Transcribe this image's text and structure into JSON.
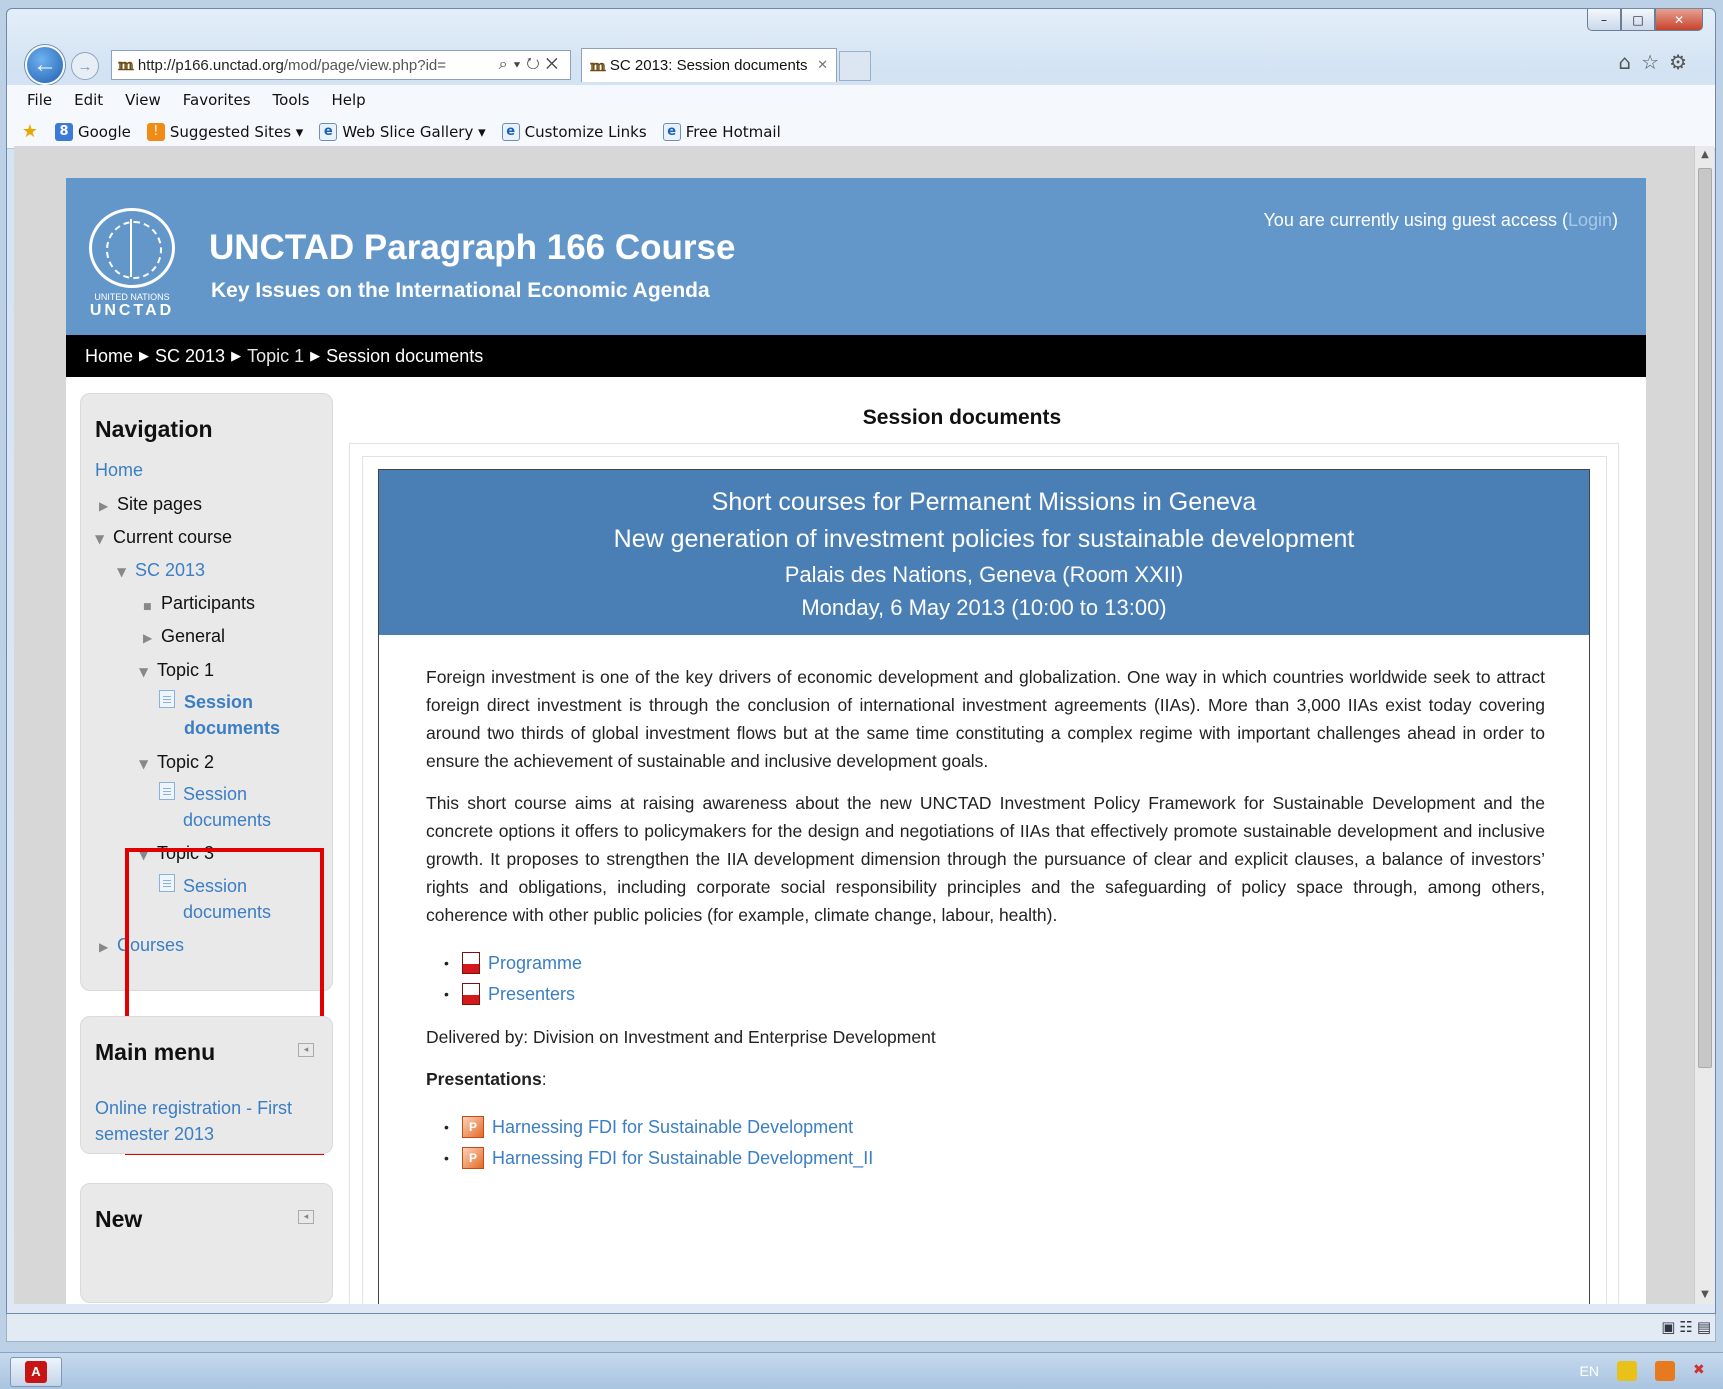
{
  "browser": {
    "url_host": "http://p166.unctad.org",
    "url_rest": "/mod/page/view.php?id=",
    "tab_title": "SC 2013: Session documents",
    "menu": [
      "File",
      "Edit",
      "View",
      "Favorites",
      "Tools",
      "Help"
    ],
    "favorites": [
      "Google",
      "Suggested Sites ▾",
      "Web Slice Gallery ▾",
      "Customize Links",
      "Free Hotmail"
    ]
  },
  "header": {
    "logo_line1": "UNITED NATIONS",
    "logo_line2": "UNCTAD",
    "title": "UNCTAD Paragraph 166 Course",
    "subtitle": "Key Issues on the International Economic Agenda",
    "guest_text": "You are currently using guest access (",
    "login_label": "Login",
    "guest_close": ")"
  },
  "breadcrumb": [
    "Home",
    "SC 2013",
    "Topic 1",
    "Session documents"
  ],
  "navigation": {
    "title": "Navigation",
    "home": "Home",
    "site_pages": "Site pages",
    "current_course": "Current course",
    "sc2013": "SC 2013",
    "participants": "Participants",
    "general": "General",
    "topic1": "Topic 1",
    "topic2": "Topic 2",
    "topic3": "Topic 3",
    "session": "Session",
    "documents": "documents",
    "courses": "Courses"
  },
  "main_menu": {
    "title": "Main menu",
    "link": "Online registration - First semester 2013"
  },
  "new_block": {
    "title": "New"
  },
  "content": {
    "heading": "Session documents",
    "banner_line1": "Short courses for Permanent Missions in Geneva",
    "banner_line2": "New generation of investment policies for sustainable development",
    "banner_line3": "Palais des Nations, Geneva (Room XXII)",
    "banner_line4": "Monday, 6 May 2013 (10:00 to 13:00)",
    "para1": "Foreign investment is one of the key drivers of economic development and globalization. One way in which countries worldwide seek to attract foreign direct investment is through the conclusion of international investment agreements (IIAs). More than 3,000 IIAs exist today covering around two thirds of global investment flows but at the same time constituting a complex regime with important challenges ahead in order to ensure the achievement of sustainable and inclusive development goals.",
    "para2": "This short course aims at raising awareness about the new UNCTAD Investment Policy Framework for Sustainable Development and the concrete options it offers to policymakers for the design and negotiations of IIAs that effectively promote sustainable development and inclusive growth. It proposes to strengthen the IIA development dimension through the pursuance of clear and explicit clauses, a balance of investors’ rights and obligations, including corporate social responsibility principles and the safeguarding of policy space through, among others, coherence with other public policies (for example, climate change, labour, health).",
    "doc_programme": "Programme",
    "doc_presenters": "Presenters",
    "delivered": "Delivered by: Division on Investment and Enterprise Development",
    "presentations_label": "Presentations",
    "presentations_colon": ":",
    "pres1": "Harnessing FDI for Sustainable Development",
    "pres2": "Harnessing FDI for Sustainable Development_II"
  },
  "taskbar": {
    "lang": "EN"
  }
}
